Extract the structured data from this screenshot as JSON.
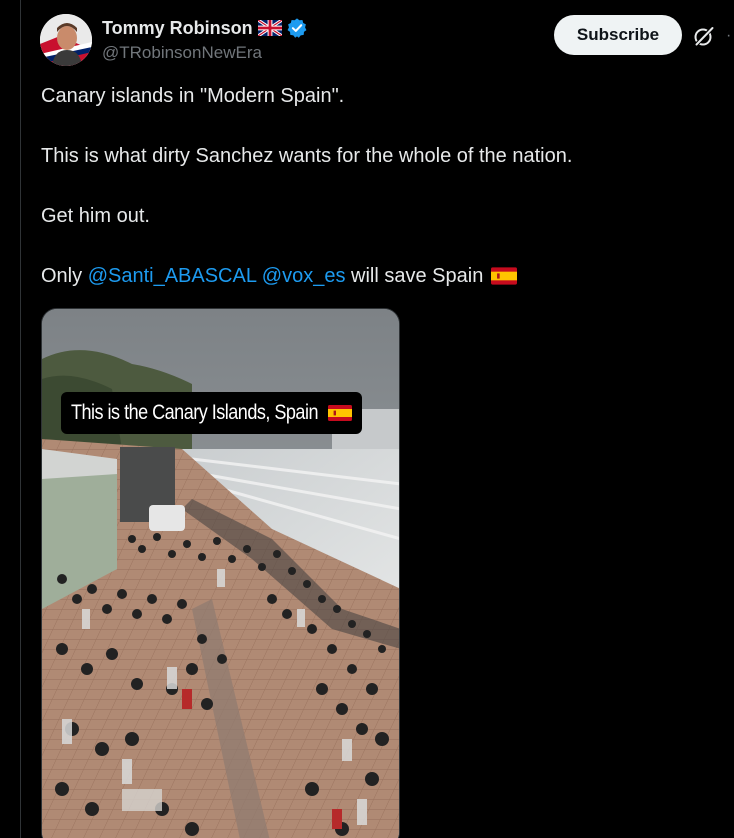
{
  "author": {
    "display_name": "Tommy Robinson",
    "handle": "@TRobinsonNewEra",
    "flag_icon": "uk-flag-icon",
    "verified_icon": "verified-badge-icon",
    "verified_color": "#1d9bf0"
  },
  "actions": {
    "subscribe_label": "Subscribe",
    "grok_icon": "grok-icon",
    "more_icon": "more-icon"
  },
  "tweet": {
    "line1": "Canary islands in \"Modern Spain\".",
    "line2": "This is what dirty Sanchez wants for the whole of the nation.",
    "line3": "Get him out.",
    "line4_prefix": "Only ",
    "mention1": "@Santi_ABASCAL",
    "mention_sep": " ",
    "mention2": "@vox_es",
    "line4_suffix": " will save Spain ",
    "flag_icon": "spain-flag-icon",
    "mention_color": "#1d9bf0"
  },
  "media": {
    "caption": "This is the Canary Islands, Spain",
    "caption_flag_icon": "spain-flag-icon"
  },
  "colors": {
    "background": "#000000",
    "text": "#e7e9ea",
    "secondary": "#71767b",
    "button_bg": "#eff3f4"
  }
}
